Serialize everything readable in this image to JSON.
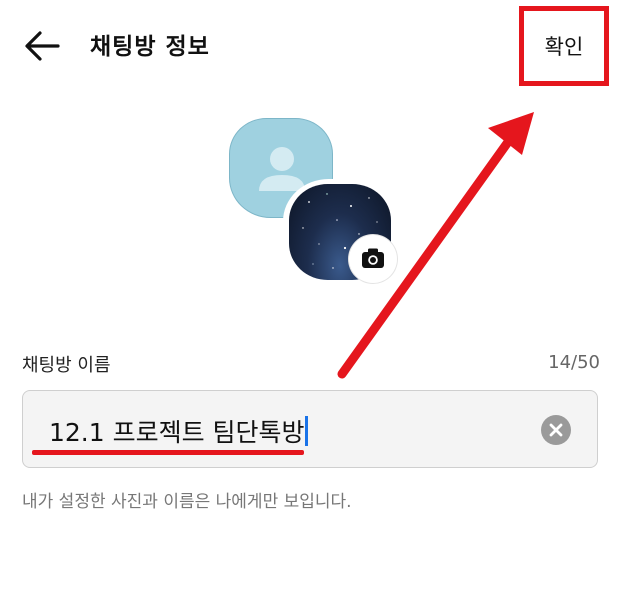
{
  "header": {
    "back_icon": "arrow-left-icon",
    "title": "채팅방 정보",
    "confirm_label": "확인"
  },
  "profile": {
    "default_avatar_icon": "person-icon",
    "camera_icon": "camera-icon"
  },
  "name_field": {
    "label": "채팅방 이름",
    "count": "14/50",
    "value": "12.1 프로젝트 팀단톡방",
    "clear_icon": "clear-icon"
  },
  "hint": "내가 설정한 사진과 이름은 나에게만 보입니다.",
  "colors": {
    "annotation_red": "#e5161d",
    "avatar_blue": "#9fd1e0",
    "caret_blue": "#1a73e8"
  }
}
